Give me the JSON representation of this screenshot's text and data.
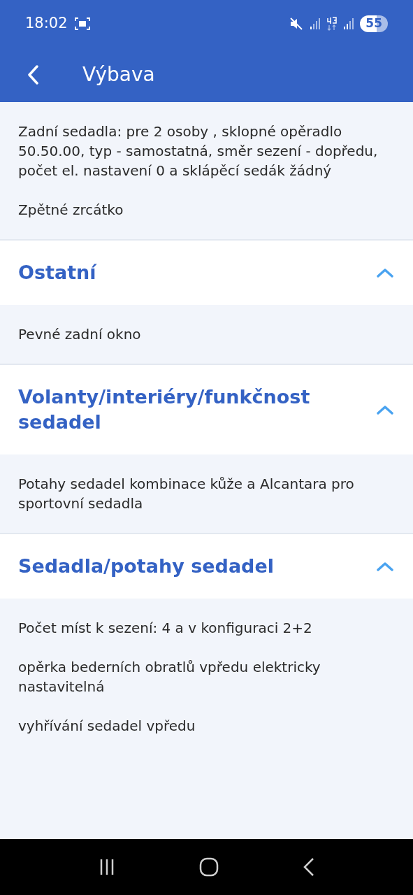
{
  "status_bar": {
    "time": "18:02",
    "battery": "55"
  },
  "app_bar": {
    "title": "Výbava"
  },
  "sections": [
    {
      "items": [
        "Zadní sedadla: pre 2 osoby , sklopné opěradlo 50.50.00, typ - samostatná, směr sezení - dopředu, počet el. nastavení 0 a sklápěcí sedák žádný",
        "Zpětné zrcátko"
      ]
    },
    {
      "title": "Ostatní",
      "expanded": true,
      "items": [
        "Pevné zadní okno"
      ]
    },
    {
      "title": "Volanty/interiéry/funkčnost sedadel",
      "expanded": true,
      "items": [
        "Potahy sedadel kombinace kůže a Alcantara pro sportovní sedadla"
      ]
    },
    {
      "title": "Sedadla/potahy sedadel",
      "expanded": true,
      "items": [
        "Počet míst k sezení: 4 a v konfiguraci 2+2",
        "opěrka bederních obratlů vpředu elektricky nastavitelná",
        "vyhřívání sedadel vpředu"
      ]
    }
  ]
}
